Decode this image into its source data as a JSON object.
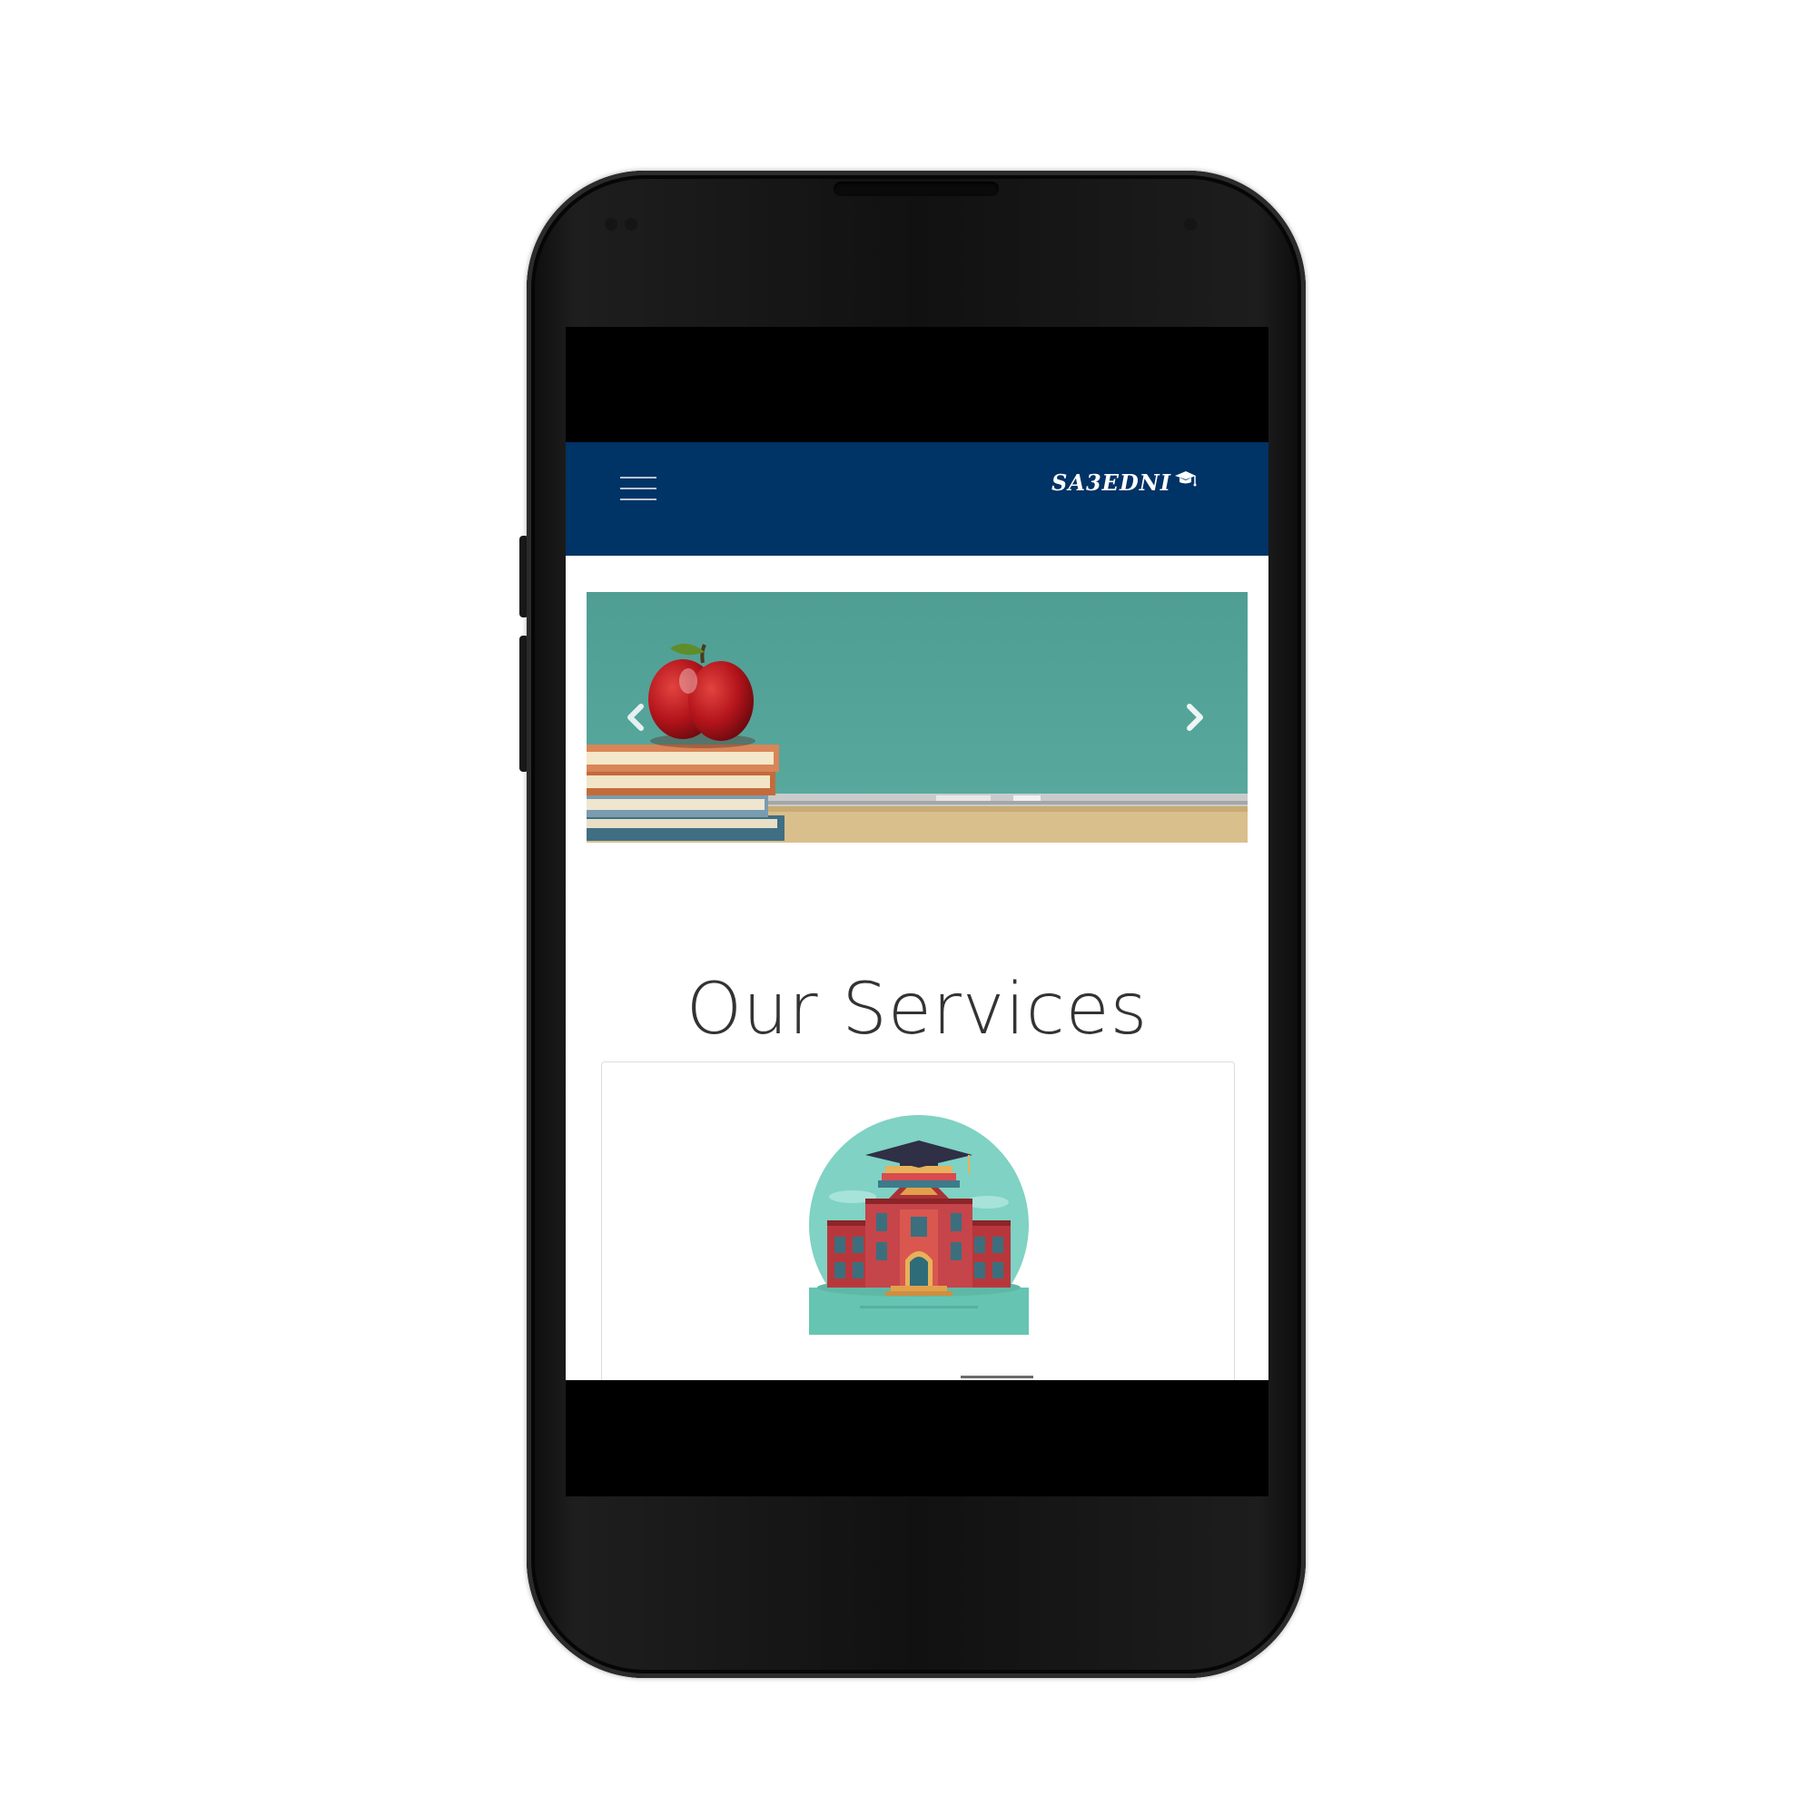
{
  "app": {
    "brand_text": "SA3EDNI",
    "nav_color": "#003366"
  },
  "navbar": {
    "menu_icon": "hamburger-menu-icon",
    "logo_icon": "graduation-cap-icon"
  },
  "hero": {
    "prev_icon": "chevron-left-icon",
    "next_icon": "chevron-right-icon"
  },
  "services": {
    "title": "Our Services",
    "card_image": "school-building-illustration"
  }
}
